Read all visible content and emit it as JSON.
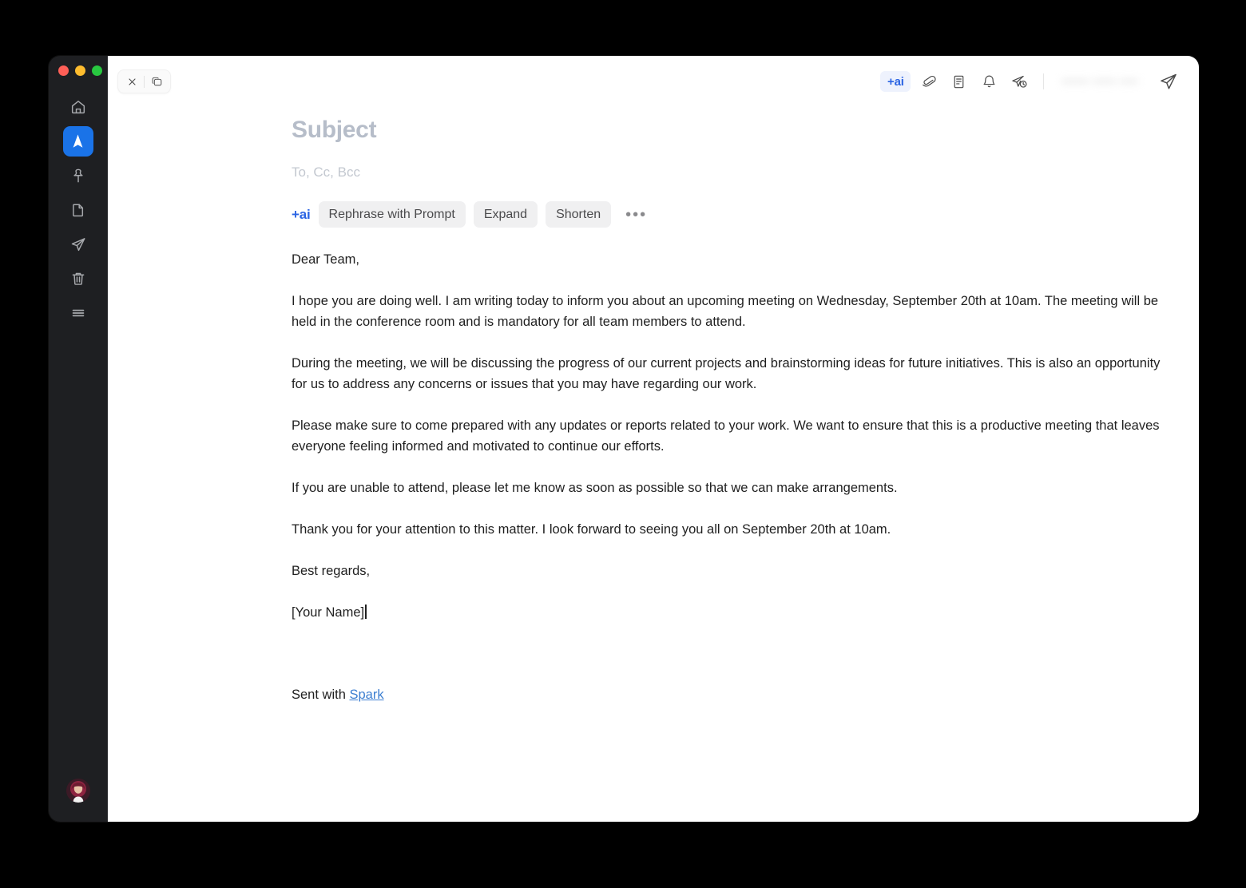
{
  "window": {
    "traffic_lights": [
      "close",
      "minimize",
      "maximize"
    ],
    "accent_blue": "#1a73e8",
    "sidebar_bg": "#1e1f22"
  },
  "sidebar": {
    "items": [
      {
        "name": "home",
        "label": "Home",
        "active": false
      },
      {
        "name": "spark",
        "label": "Spark",
        "active": true
      },
      {
        "name": "pin",
        "label": "Pinned",
        "active": false
      },
      {
        "name": "document",
        "label": "Drafts",
        "active": false
      },
      {
        "name": "send",
        "label": "Sent",
        "active": false
      },
      {
        "name": "trash",
        "label": "Trash",
        "active": false
      },
      {
        "name": "menu",
        "label": "Menu",
        "active": false
      }
    ],
    "avatar": {
      "name": "user-avatar",
      "label": "Account"
    }
  },
  "toolbar": {
    "close_label": "×",
    "window_mode_label": "Window mode",
    "ai_chip_label": "+ai",
    "items": [
      {
        "name": "attachment-icon",
        "label": "Attach file"
      },
      {
        "name": "template-icon",
        "label": "Templates"
      },
      {
        "name": "bell-icon",
        "label": "Follow up reminder"
      },
      {
        "name": "send-later-icon",
        "label": "Send later"
      }
    ],
    "redacted_text": "••••••  •••••  ••••",
    "send_label": "Send"
  },
  "compose": {
    "subject_placeholder": "Subject",
    "recipients_placeholder": "To, Cc, Bcc"
  },
  "ai_toolbar": {
    "prefix": "+ai",
    "buttons": [
      {
        "name": "rephrase-with-prompt",
        "label": "Rephrase with Prompt"
      },
      {
        "name": "expand",
        "label": "Expand"
      },
      {
        "name": "shorten",
        "label": "Shorten"
      }
    ],
    "more_label": "•••"
  },
  "email": {
    "greeting": "Dear Team,",
    "paragraphs": [
      "I hope you are doing well. I am writing today to inform you about an upcoming meeting on Wednesday, September 20th at 10am. The meeting will be held in the conference room and is mandatory for all team members to attend.",
      "During the meeting, we will be discussing the progress of our current projects and brainstorming ideas for future initiatives. This is also an opportunity for us to address any concerns or issues that you may have regarding our work.",
      "Please make sure to come prepared with any updates or reports related to your work. We want to ensure that this is a productive meeting that leaves everyone feeling informed and motivated to continue our efforts.",
      "If you are unable to attend, please let me know as soon as possible so that we can make arrangements.",
      "Thank you for your attention to this matter. I look forward to seeing you all on September 20th at 10am."
    ],
    "closing": "Best regards,",
    "signature_name": "[Your Name]",
    "footer_prefix": "Sent with ",
    "footer_link": "Spark"
  }
}
